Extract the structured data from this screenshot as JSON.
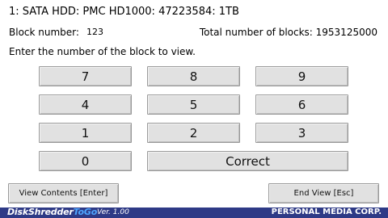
{
  "device_line": "1: SATA HDD: PMC HD1000: 47223584: 1TB",
  "block_number_label": "Block number:",
  "block_number_value": "123",
  "total_blocks_text": "Total number of blocks: 1953125000",
  "prompt": "Enter the number of the block to view.",
  "keypad": {
    "k7": "7",
    "k8": "8",
    "k9": "9",
    "k4": "4",
    "k5": "5",
    "k6": "6",
    "k1": "1",
    "k2": "2",
    "k3": "3",
    "k0": "0",
    "correct": "Correct"
  },
  "buttons": {
    "view_contents": "View Contents [Enter]",
    "end_view": "End View [Esc]"
  },
  "footer": {
    "logo_part1": "DiskShredder",
    "logo_part2": "ToGo",
    "version": "Ver. 1.00",
    "company": "PERSONAL MEDIA CORP."
  }
}
